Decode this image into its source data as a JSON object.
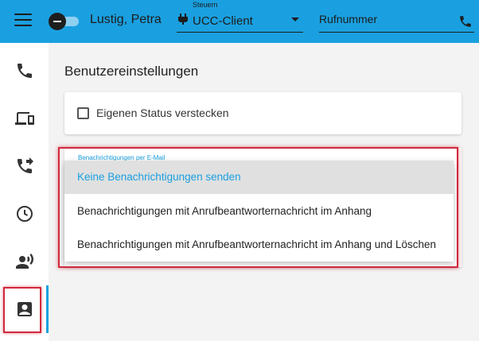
{
  "colors": {
    "accent": "#1aa0e0",
    "highlight": "#d0293c",
    "selected_bg": "#e0e0e0"
  },
  "header": {
    "menu_icon": "hamburger-icon",
    "status_toggle_icon": "presence-toggle-icon",
    "user_name": "Lustig, Petra",
    "control": {
      "label": "Steuern",
      "value": "UCC-Client",
      "icon": "plug-icon"
    },
    "phone_input": {
      "placeholder": "Rufnummer",
      "icon": "phone-icon"
    }
  },
  "sidebar": {
    "items": [
      {
        "name": "calls",
        "icon": "phone-icon"
      },
      {
        "name": "devices",
        "icon": "devices-icon"
      },
      {
        "name": "forwarding",
        "icon": "call-forward-icon"
      },
      {
        "name": "history",
        "icon": "clock-icon"
      },
      {
        "name": "voicemail",
        "icon": "voice-icon"
      },
      {
        "name": "user-settings",
        "icon": "contact-card-icon",
        "active": true
      }
    ]
  },
  "main": {
    "title": "Benutzereinstellungen",
    "hide_status_checkbox": {
      "label": "Eigenen Status verstecken",
      "checked": false
    },
    "email_notification": {
      "label": "Benachrichtigungen per E-Mail",
      "options": [
        "Keine Benachrichtigungen senden",
        "Benachrichtigungen mit Anrufbeantworternachricht im Anhang",
        "Benachrichtigungen mit Anrufbeantworternachricht im Anhang und Löschen"
      ],
      "selected_index": 0
    }
  }
}
